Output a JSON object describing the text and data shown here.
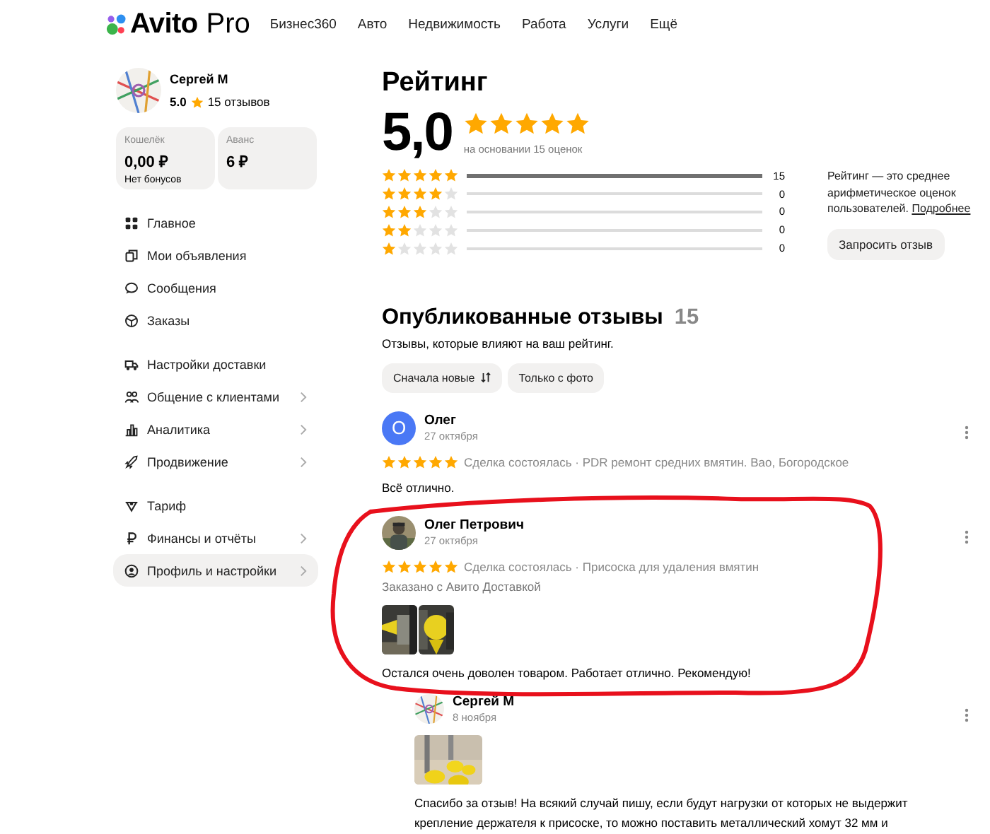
{
  "header": {
    "logo": {
      "name": "Avito",
      "suffix": "Pro"
    },
    "nav": [
      "Бизнес360",
      "Авто",
      "Недвижимость",
      "Работа",
      "Услуги",
      "Ещё"
    ]
  },
  "profile": {
    "name": "Сергей М",
    "rating": "5.0",
    "reviews": "15 отзывов"
  },
  "wallets": [
    {
      "label": "Кошелёк",
      "value": "0,00 ₽",
      "note": "Нет бонусов"
    },
    {
      "label": "Аванс",
      "value": "6 ₽"
    }
  ],
  "sidebar": {
    "groups": [
      {
        "items": [
          {
            "label": "Главное",
            "submenu": false,
            "selected": false
          },
          {
            "label": "Мои объявления",
            "submenu": false,
            "selected": false
          },
          {
            "label": "Сообщения",
            "submenu": false,
            "selected": false
          },
          {
            "label": "Заказы",
            "submenu": false,
            "selected": false
          }
        ]
      },
      {
        "items": [
          {
            "label": "Настройки доставки",
            "submenu": false,
            "selected": false
          },
          {
            "label": "Общение с клиентами",
            "submenu": true,
            "selected": false
          },
          {
            "label": "Аналитика",
            "submenu": true,
            "selected": false
          },
          {
            "label": "Продвижение",
            "submenu": true,
            "selected": false
          }
        ]
      },
      {
        "items": [
          {
            "label": "Тариф",
            "submenu": false,
            "selected": false
          },
          {
            "label": "Финансы и отчёты",
            "submenu": true,
            "selected": false
          },
          {
            "label": "Профиль и настройки",
            "submenu": true,
            "selected": true
          }
        ]
      }
    ]
  },
  "rating": {
    "title": "Рейтинг",
    "score": "5,0",
    "stars": 5,
    "basis": "на основании 15 оценок",
    "breakdown": [
      {
        "stars": 5,
        "level": 1,
        "count": "15"
      },
      {
        "stars": 4,
        "level": 0,
        "count": "0"
      },
      {
        "stars": 3,
        "level": 0,
        "count": "0"
      },
      {
        "stars": 2,
        "level": 0,
        "count": "0"
      },
      {
        "stars": 1,
        "level": 0,
        "count": "0"
      }
    ],
    "info": "Рейтинг — это среднее арифметическое оценок пользователей.",
    "info_link": "Подробнее",
    "request_button": "Запросить отзыв"
  },
  "reviews": {
    "title": "Опубликованные отзывы",
    "count": "15",
    "subtitle": "Отзывы, которые влияют на ваш рейтинг.",
    "filters": [
      {
        "label": "Сначала новые",
        "sort": true,
        "selected": false
      },
      {
        "label": "Только с фото",
        "sort": false,
        "selected": false
      }
    ],
    "items": [
      {
        "author": "Олег",
        "avatar_letter": "О",
        "date": "27 октября",
        "stars": 5,
        "meta": "Сделка состоялась · PDR ремонт средних вмятин. Вао, Богородское",
        "text": "Всё отлично."
      },
      {
        "author": "Олег Петрович",
        "date": "27 октября",
        "stars": 5,
        "meta": "Сделка состоялась · Присоска для удаления вмятин",
        "delivery": "Заказано с Авито Доставкой",
        "photos": [
          {
            "kind": "picture"
          },
          {
            "kind": "picture"
          }
        ],
        "text": "Остался очень доволен товаром. Работает отлично. Рекомендую!",
        "reply": {
          "author": "Сергей М",
          "date": "8 ноября",
          "photos": [
            {
              "kind": "picture"
            }
          ],
          "text": "Спасибо за отзыв! На всякий случай пишу, если будут нагрузки от которых не выдержит крепление держателя к присоске, то можно поставить металлический хомут 32 мм и"
        }
      }
    ]
  }
}
